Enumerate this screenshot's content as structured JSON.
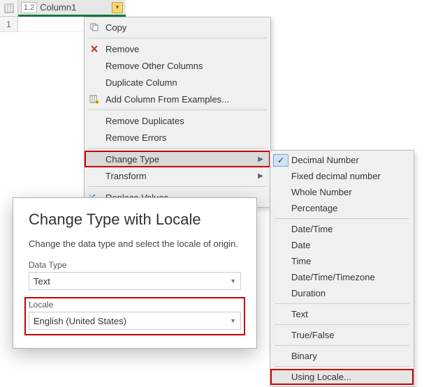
{
  "grid": {
    "column_type_chip": "1.2",
    "column_name": "Column1",
    "row_number": "1"
  },
  "context_menu": {
    "copy": "Copy",
    "remove": "Remove",
    "remove_other": "Remove Other Columns",
    "duplicate": "Duplicate Column",
    "add_from_examples": "Add Column From Examples...",
    "remove_dupes": "Remove Duplicates",
    "remove_errors": "Remove Errors",
    "change_type": "Change Type",
    "transform": "Transform",
    "replace_values": "Replace Values..."
  },
  "submenu": {
    "decimal": "Decimal Number",
    "fixed_decimal": "Fixed decimal number",
    "whole": "Whole Number",
    "percentage": "Percentage",
    "datetime": "Date/Time",
    "date": "Date",
    "time": "Time",
    "dtz": "Date/Time/Timezone",
    "duration": "Duration",
    "text": "Text",
    "truefalse": "True/False",
    "binary": "Binary",
    "using_locale": "Using Locale..."
  },
  "dialog": {
    "title": "Change Type with Locale",
    "description": "Change the data type and select the locale of origin.",
    "datatype_label": "Data Type",
    "datatype_value": "Text",
    "locale_label": "Locale",
    "locale_value": "English (United States)"
  }
}
